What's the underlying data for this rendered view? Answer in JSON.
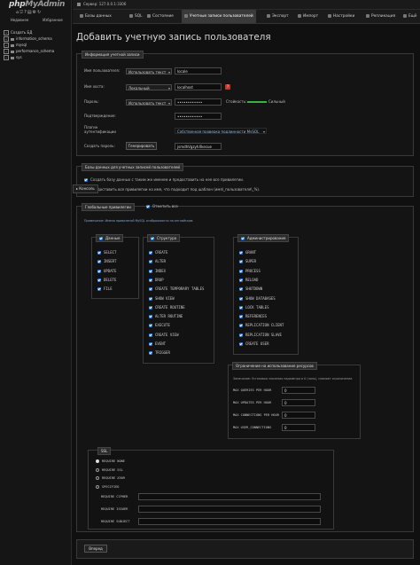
{
  "nav": {
    "logo_left": "php",
    "logo_right": "MyAdmin",
    "icons": [
      "home-icon",
      "logout-icon",
      "help-icon",
      "docs-icon",
      "gear-icon",
      "reload-icon"
    ],
    "tabs": [
      "Недавнее",
      "Избранное"
    ],
    "tree": [
      {
        "label": "Создать БД",
        "kind": "new"
      },
      {
        "label": "information_schema",
        "kind": "db"
      },
      {
        "label": "mysql",
        "kind": "db"
      },
      {
        "label": "performance_schema",
        "kind": "db"
      },
      {
        "label": "sys",
        "kind": "db"
      }
    ],
    "console_label": "Консоль"
  },
  "serverbar": {
    "text": "Сервер: 127.0.0.1:3306"
  },
  "tabs": [
    {
      "label": "Базы данных"
    },
    {
      "label": "SQL"
    },
    {
      "label": "Состояние"
    },
    {
      "label": "Учетные записи пользователей",
      "active": true
    },
    {
      "label": "Экспорт"
    },
    {
      "label": "Импорт"
    },
    {
      "label": "Настройки"
    },
    {
      "label": "Репликация"
    },
    {
      "label": "Ещё"
    }
  ],
  "title": "Добавить учетную запись пользователя",
  "login": {
    "legend": "Информация учетной записи",
    "username_label": "Имя пользователя:",
    "username_type": "Использовать текст",
    "username_value": "locale",
    "host_label": "Имя хоста:",
    "host_type": "Локальный",
    "host_value": "localhost",
    "host_help": "?",
    "password_label": "Пароль:",
    "password_type": "Использовать текст",
    "password_value": "••••••••••••",
    "strength_label": "Стойкость:",
    "strength_value": "Сильный",
    "strength_color": "#3cb043",
    "retype_label": "Подтверждение:",
    "retype_value": "••••••••••••",
    "auth_label_1": "Плагин",
    "auth_label_2": "аутентификации",
    "auth_value": "Собственная проверка подлинности MySQL",
    "gen_label": "Создать пароль:",
    "gen_button": "Генерировать",
    "gen_value": "jsmdhVgzyhXkecue"
  },
  "db_section": {
    "legend": "Базы данных для учетных записей пользователей",
    "option1": "Создать базу данных с таким же именем и предоставить на нее все привилегии.",
    "option2": "Предоставить все привилегии на имя, что подходит под шаблон (имя\\_пользователя\\_%)."
  },
  "global": {
    "legend": "Глобальные привилегии",
    "check_all": "Отметить все",
    "note": "Примечание: Имена привилегий MySQL отображаются на английском.",
    "data": {
      "legend": "Данные",
      "items": [
        "SELECT",
        "INSERT",
        "UPDATE",
        "DELETE",
        "FILE"
      ]
    },
    "structure": {
      "legend": "Структура",
      "items": [
        "CREATE",
        "ALTER",
        "INDEX",
        "DROP",
        "CREATE TEMPORARY TABLES",
        "SHOW VIEW",
        "CREATE ROUTINE",
        "ALTER ROUTINE",
        "EXECUTE",
        "CREATE VIEW",
        "EVENT",
        "TRIGGER"
      ]
    },
    "admin": {
      "legend": "Администрирование",
      "items": [
        "GRANT",
        "SUPER",
        "PROCESS",
        "RELOAD",
        "SHUTDOWN",
        "SHOW DATABASES",
        "LOCK TABLES",
        "REFERENCES",
        "REPLICATION CLIENT",
        "REPLICATION SLAVE",
        "CREATE USER"
      ]
    }
  },
  "limits": {
    "legend": "Ограничение на использование ресурсов",
    "note": "Замечание: Установка значения параметра в 0 (ноль), снимает ограничение.",
    "rows": [
      {
        "label": "MAX QUERIES PER HOUR",
        "value": "0"
      },
      {
        "label": "MAX UPDATES PER HOUR",
        "value": "0"
      },
      {
        "label": "MAX CONNECTIONS PER HOUR",
        "value": "0"
      },
      {
        "label": "MAX USER_CONNECTIONS",
        "value": "0"
      }
    ]
  },
  "ssl": {
    "legend": "SSL",
    "options": [
      {
        "label": "REQUIRE NONE",
        "selected": true
      },
      {
        "label": "REQUIRE SSL",
        "selected": false
      },
      {
        "label": "REQUIRE X509",
        "selected": false
      },
      {
        "label": "SPECIFIED",
        "selected": false
      }
    ],
    "fields": [
      {
        "label": "REQUIRE CIPHER",
        "value": ""
      },
      {
        "label": "REQUIRE ISSUER",
        "value": ""
      },
      {
        "label": "REQUIRE SUBJECT",
        "value": ""
      }
    ]
  },
  "submit": "Вперед"
}
